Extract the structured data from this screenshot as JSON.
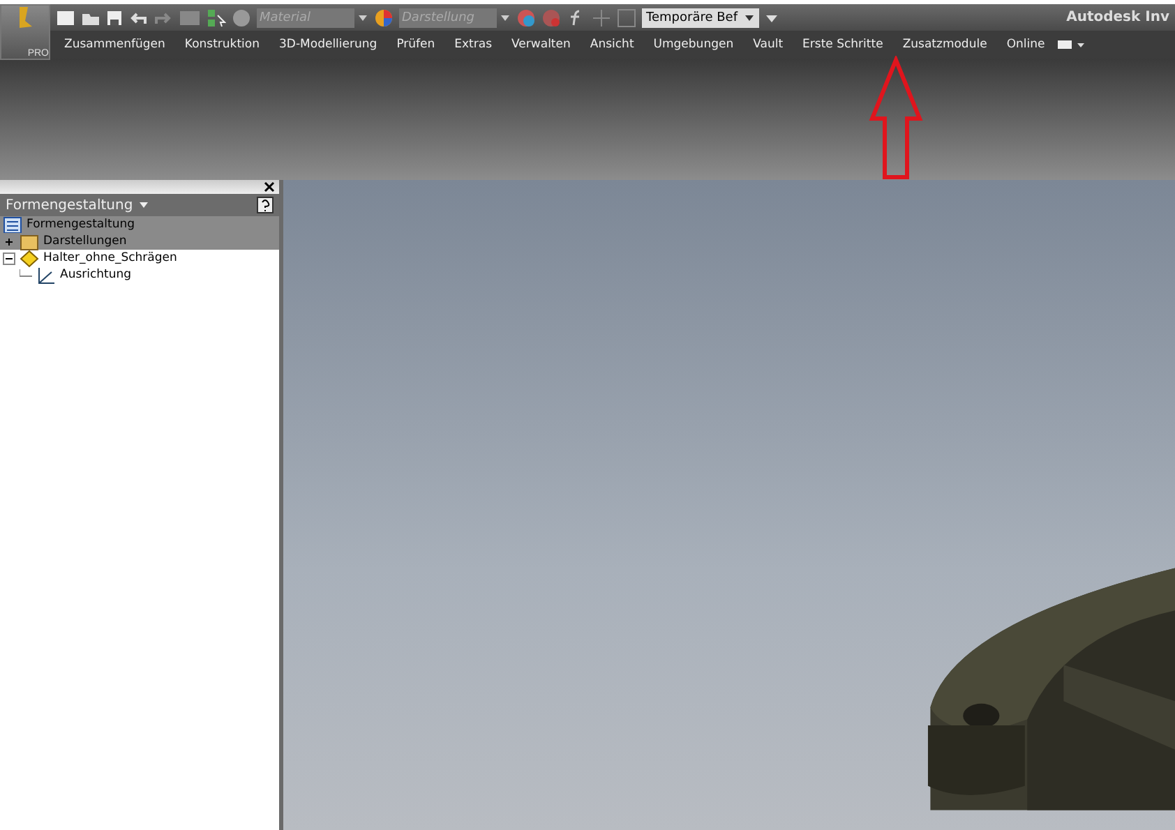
{
  "app_button": {
    "label": "PRO"
  },
  "quick_access": {
    "material_field": {
      "placeholder": "Material"
    },
    "appearance_field": {
      "placeholder": "Darstellung"
    },
    "command_field": {
      "value": "Temporäre Bef"
    }
  },
  "window": {
    "title": "Autodesk Inv"
  },
  "tabs": [
    {
      "label": "Zusammenfügen",
      "selected": false
    },
    {
      "label": "Konstruktion",
      "selected": false
    },
    {
      "label": "3D-Modellierung",
      "selected": false
    },
    {
      "label": "Prüfen",
      "selected": false
    },
    {
      "label": "Extras",
      "selected": false
    },
    {
      "label": "Verwalten",
      "selected": false
    },
    {
      "label": "Ansicht",
      "selected": false
    },
    {
      "label": "Umgebungen",
      "selected": false
    },
    {
      "label": "Vault",
      "selected": false
    },
    {
      "label": "Erste Schritte",
      "selected": false
    },
    {
      "label": "Zusatzmodule",
      "selected": false
    },
    {
      "label": "Online",
      "selected": false
    }
  ],
  "browser": {
    "title": "Formengestaltung",
    "items": [
      {
        "kind": "document",
        "label": "Formengestaltung",
        "selected": true
      },
      {
        "kind": "representations",
        "label": "Darstellungen",
        "selected": true,
        "expanded": false
      },
      {
        "kind": "part",
        "label": "Halter_ohne_Schrägen",
        "selected": false,
        "expanded": true,
        "children": [
          {
            "kind": "origin",
            "label": "Ausrichtung",
            "selected": false
          }
        ]
      }
    ]
  }
}
